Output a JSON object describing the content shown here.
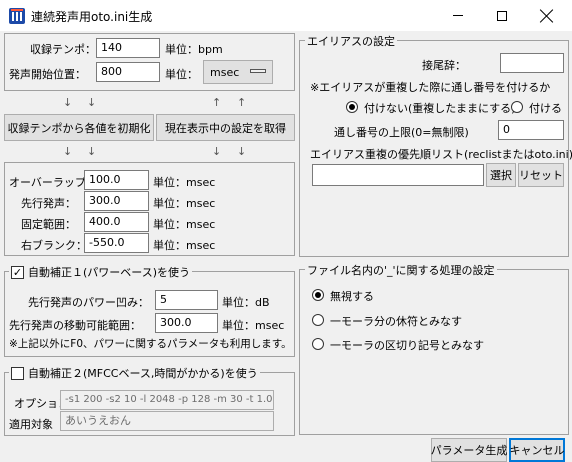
{
  "window": {
    "title": "連続発声用oto.ini生成"
  },
  "recording": {
    "tempo_label": "収録テンポ：",
    "tempo_value": "140",
    "tempo_unit": "単位：bpm",
    "start_label": "発声開始位置：",
    "start_value": "800",
    "start_unit_label": "単位：",
    "start_unit_value": "msec"
  },
  "arrows": {
    "down": "↓",
    "up": "↑"
  },
  "buttons": {
    "init_from_tempo": "収録テンポから各値を初期化",
    "get_current": "現在表示中の設定を取得",
    "select": "選択",
    "reset": "リセット",
    "generate": "パラメータ生成",
    "cancel": "キャンセル"
  },
  "params": {
    "overlap_label": "オーバーラップ：",
    "overlap_value": "100.0",
    "preutter_label": "先行発声：",
    "preutter_value": "300.0",
    "fixed_label": "固定範囲：",
    "fixed_value": "400.0",
    "blank_label": "右ブランク：",
    "blank_value": "-550.0",
    "unit": "単位：msec"
  },
  "autocorrect1": {
    "title": "自動補正１(パワーベース)を使う",
    "checked": true,
    "dip_label": "先行発声のパワー凹み：",
    "dip_value": "5",
    "dip_unit": "単位：dB",
    "range_label": "先行発声の移動可能範囲：",
    "range_value": "300.0",
    "range_unit": "単位：msec",
    "note": "※上記以外にF0、パワーに関するパラメータも利用します。"
  },
  "autocorrect2": {
    "title": "自動補正２(MFCCベース,時間がかかる)を使う",
    "checked": false,
    "options_label": "オプション",
    "options_value": "-s1 200 -s2 10 -l 2048 -p 128 -m 30 -t 1.0",
    "target_label": "適用対象",
    "target_value": "あいうえおん"
  },
  "alias": {
    "title": "エイリアスの設定",
    "suffix_label": "接尾辞：",
    "suffix_value": "",
    "dup_note": "※エイリアスが重複した際に通し番号を付けるか",
    "radio_no": "付けない(重複したままにする)",
    "radio_yes": "付ける",
    "selected": "no",
    "limit_label": "通し番号の上限(0=無制限)",
    "limit_value": "0",
    "priority_label": "エイリアス重複の優先順リスト(reclistまたはoto.ini)：",
    "priority_value": ""
  },
  "filename": {
    "title": "ファイル名内の'_'に関する処理の設定",
    "options": [
      "無視する",
      "一モーラ分の休符とみなす",
      "一モーラの区切り記号とみなす"
    ],
    "selected_index": 0
  }
}
